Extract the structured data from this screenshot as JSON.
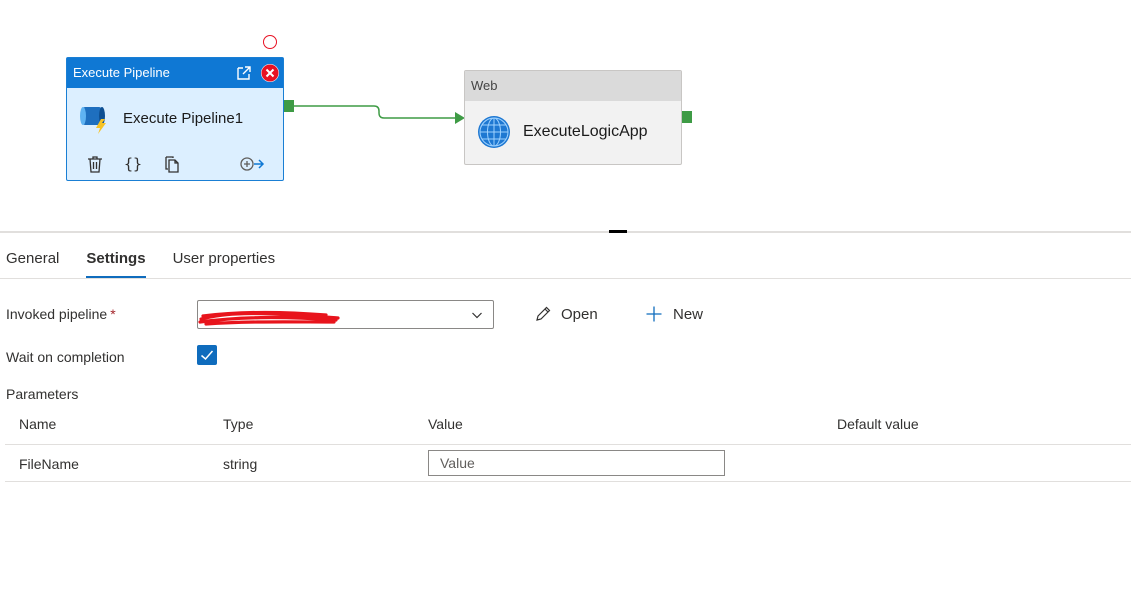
{
  "canvas": {
    "execute_node": {
      "header_title": "Execute Pipeline",
      "activity_name": "Execute Pipeline1",
      "tools": [
        "delete-icon",
        "code-icon",
        "copy-icon",
        "add-output-icon"
      ]
    },
    "web_node": {
      "header_title": "Web",
      "activity_name": "ExecuteLogicApp"
    }
  },
  "tabs": [
    {
      "label": "General",
      "active": false
    },
    {
      "label": "Settings",
      "active": true
    },
    {
      "label": "User properties",
      "active": false
    }
  ],
  "settings": {
    "invoked_pipeline_label": "Invoked pipeline",
    "required_marker": "*",
    "invoked_pipeline_value": "",
    "open_label": "Open",
    "new_label": "New",
    "wait_on_completion_label": "Wait on completion",
    "wait_on_completion_checked": true,
    "parameters_label": "Parameters",
    "columns": {
      "name": "Name",
      "type": "Type",
      "value": "Value",
      "default_value": "Default value"
    },
    "rows": [
      {
        "name": "FileName",
        "type": "string",
        "value": "",
        "value_placeholder": "Value",
        "default_value": ""
      }
    ]
  },
  "colors": {
    "accent": "#0f6cbd",
    "node_header": "#0f78d4",
    "node_body": "#dcefff",
    "port_green": "#3e9b45",
    "error_red": "#e81123"
  }
}
